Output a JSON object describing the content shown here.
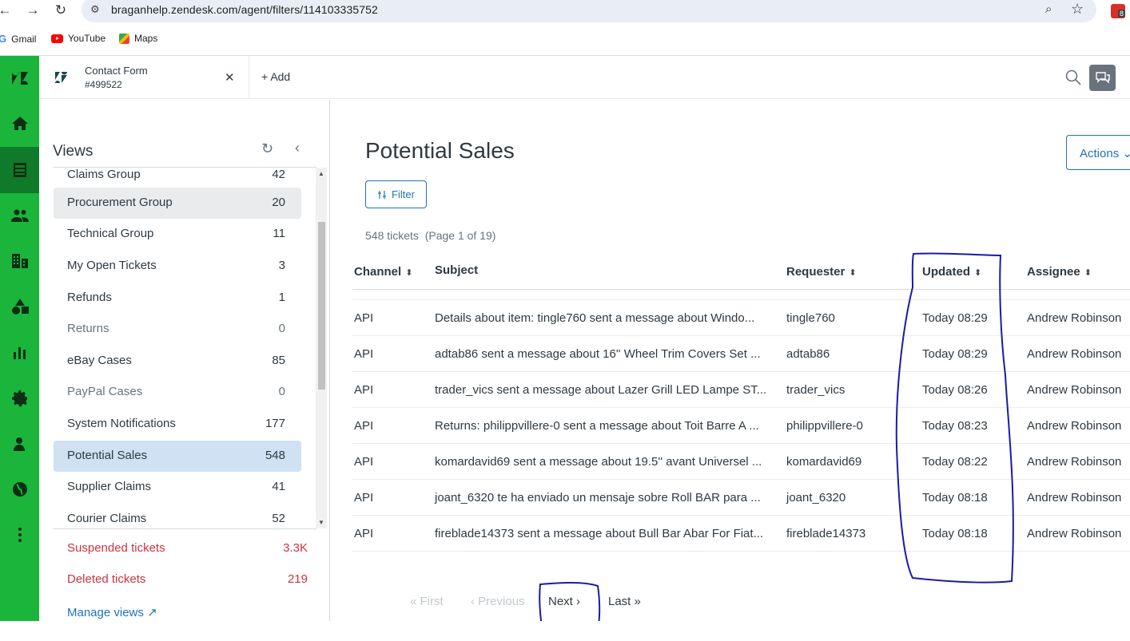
{
  "browser": {
    "url": "braganhelp.zendesk.com/agent/filters/114103335752",
    "ext_badge": "8",
    "bookmarks": [
      "Gmail",
      "YouTube",
      "Maps"
    ]
  },
  "tabbar": {
    "tab_title": "Contact Form",
    "tab_sub": "#499522",
    "add_label": "Add"
  },
  "views": {
    "title": "Views",
    "items": [
      {
        "label": "Claims Group",
        "count": "42"
      },
      {
        "label": "Procurement Group",
        "count": "20"
      },
      {
        "label": "Technical Group",
        "count": "11"
      },
      {
        "label": "My Open Tickets",
        "count": "3"
      },
      {
        "label": "Refunds",
        "count": "1"
      },
      {
        "label": "Returns",
        "count": "0"
      },
      {
        "label": "eBay Cases",
        "count": "85"
      },
      {
        "label": "PayPal Cases",
        "count": "0"
      },
      {
        "label": "System Notifications",
        "count": "177"
      },
      {
        "label": "Potential Sales",
        "count": "548"
      },
      {
        "label": "Supplier Claims",
        "count": "41"
      },
      {
        "label": "Courier Claims",
        "count": "52"
      }
    ],
    "suspended": {
      "label": "Suspended tickets",
      "count": "3.3K"
    },
    "deleted": {
      "label": "Deleted tickets",
      "count": "219"
    },
    "manage": "Manage views"
  },
  "main": {
    "title": "Potential Sales",
    "actions": "Actions",
    "filter": "Filter",
    "ticket_count": "548 tickets",
    "page_info": "(Page 1 of 19)",
    "columns": {
      "channel": "Channel",
      "subject": "Subject",
      "requester": "Requester",
      "updated": "Updated",
      "assignee": "Assignee"
    },
    "rows": [
      {
        "channel": "API",
        "subject": "Details about item: tingle760 sent a message about Windo...",
        "requester": "tingle760",
        "updated": "Today 08:29",
        "assignee": "Andrew Robinson"
      },
      {
        "channel": "API",
        "subject": "adtab86 sent a message about 16'' Wheel Trim Covers Set ...",
        "requester": "adtab86",
        "updated": "Today 08:29",
        "assignee": "Andrew Robinson"
      },
      {
        "channel": "API",
        "subject": "trader_vics sent a message about Lazer Grill LED Lampe ST...",
        "requester": "trader_vics",
        "updated": "Today 08:26",
        "assignee": "Andrew Robinson"
      },
      {
        "channel": "API",
        "subject": "Returns: philippvillere-0 sent a message about Toit Barre A ...",
        "requester": "philippvillere-0",
        "updated": "Today 08:23",
        "assignee": "Andrew Robinson"
      },
      {
        "channel": "API",
        "subject": "komardavid69 sent a message about 19.5'' avant Universel ...",
        "requester": "komardavid69",
        "updated": "Today 08:22",
        "assignee": "Andrew Robinson"
      },
      {
        "channel": "API",
        "subject": "joant_6320 te ha enviado un mensaje sobre Roll BAR para ...",
        "requester": "joant_6320",
        "updated": "Today 08:18",
        "assignee": "Andrew Robinson"
      },
      {
        "channel": "API",
        "subject": "fireblade14373 sent a message about Bull Bar Abar For Fiat...",
        "requester": "fireblade14373",
        "updated": "Today 08:18",
        "assignee": "Andrew Robinson"
      }
    ],
    "pager": {
      "first": "First",
      "previous": "Previous",
      "next": "Next",
      "last": "Last"
    }
  },
  "colors": {
    "nav_green": "#1bb53c",
    "nav_active": "#0f7a2a",
    "link_blue": "#1f73b7",
    "danger": "#cc3340",
    "selected": "#cfe1f3",
    "annotation": "#1a1aa8"
  }
}
